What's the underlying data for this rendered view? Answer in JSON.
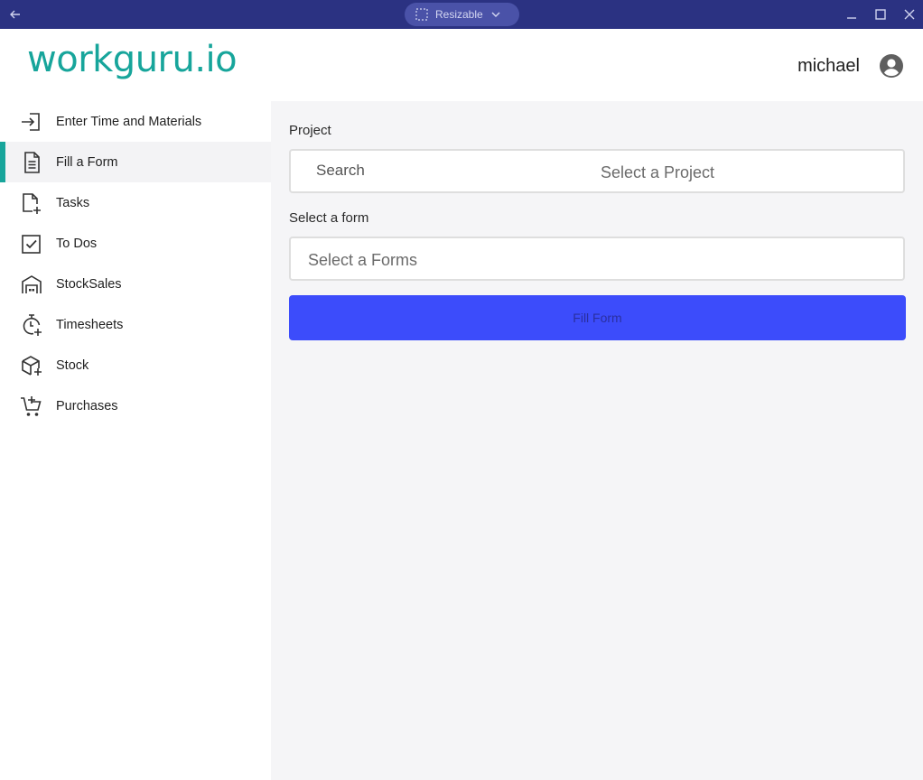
{
  "titlebar": {
    "mode_label": "Resizable",
    "icons": [
      "back-arrow-icon",
      "resize-icon",
      "chevron-down-icon",
      "minimize-icon",
      "maximize-icon",
      "close-icon"
    ]
  },
  "header": {
    "logo_text": "workguru.io",
    "username": "michael",
    "avatar_icon": "account-circle-icon"
  },
  "colors": {
    "titlebar": "#2b3282",
    "brand": "#17a59b",
    "primary_button": "#3c4cfb",
    "page_bg": "#f5f5f7"
  },
  "sidebar": {
    "active_index": 1,
    "items": [
      {
        "label": "Enter Time and Materials",
        "icon": "login-icon"
      },
      {
        "label": "Fill a Form",
        "icon": "document-icon"
      },
      {
        "label": "Tasks",
        "icon": "file-add-icon"
      },
      {
        "label": "To Dos",
        "icon": "checkbox-icon"
      },
      {
        "label": "StockSales",
        "icon": "warehouse-icon"
      },
      {
        "label": "Timesheets",
        "icon": "timer-add-icon"
      },
      {
        "label": "Stock",
        "icon": "package-icon"
      },
      {
        "label": "Purchases",
        "icon": "cart-add-icon"
      }
    ]
  },
  "main": {
    "project_label": "Project",
    "project_search_placeholder": "Search",
    "project_placeholder": "Select a Project",
    "form_label": "Select a form",
    "form_placeholder": "Select a Forms",
    "fill_button_label": "Fill Form"
  }
}
